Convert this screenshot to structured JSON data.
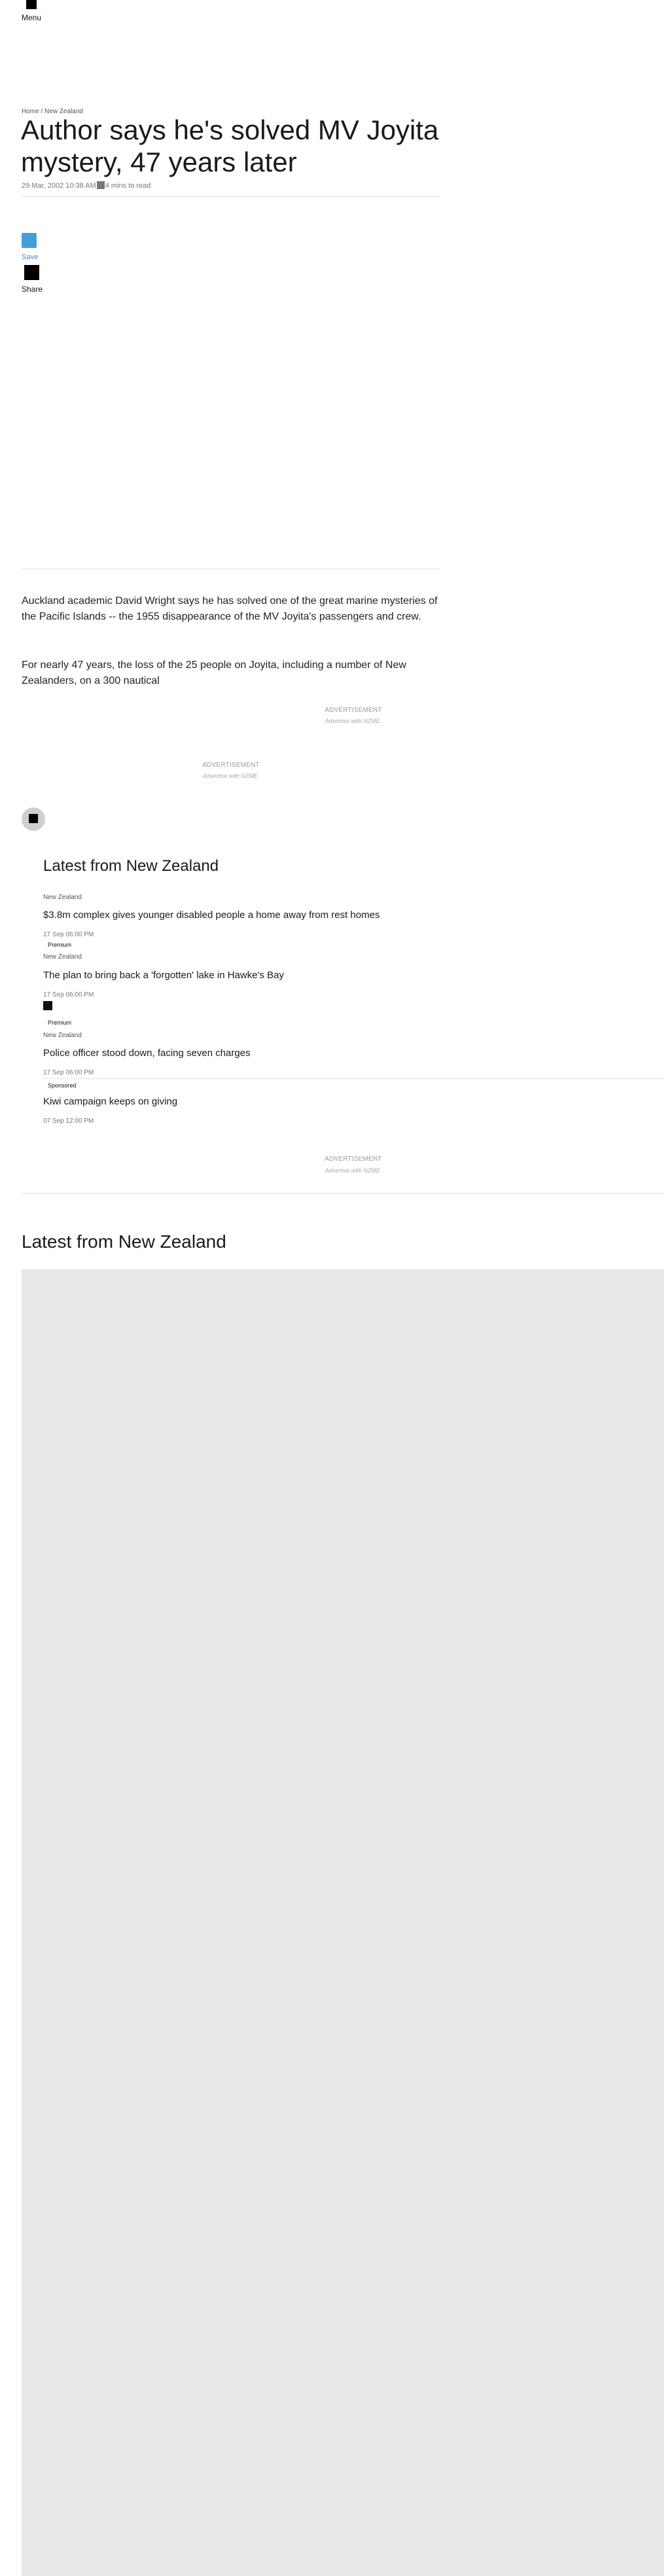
{
  "nav": {
    "menu_label": "Menu"
  },
  "breadcrumb": {
    "home": "Home",
    "separator": " / ",
    "section": "New Zealand"
  },
  "article": {
    "headline": "Author says he's solved MV Joyita mystery, 47 years later",
    "date": "29 Mar, 2002 10:38 AM",
    "read_time": "4 mins to read",
    "paragraph_1": "Auckland academic David Wright says he has solved one of the great marine mysteries of the Pacific Islands -- the 1955 disappearance of the MV Joyita's passengers and crew.",
    "paragraph_2": "For nearly 47 years, the loss of the 25 people on Joyita, including a number of New Zealanders, on a 300 nautical"
  },
  "actions": {
    "save_label": "Save",
    "share_label": "Share"
  },
  "ads": {
    "label": "ADVERTISEMENT",
    "link": "Advertise with NZME."
  },
  "latest": {
    "title": "Latest from New Zealand",
    "items": [
      {
        "section": "New Zealand",
        "title": "$3.8m complex gives younger disabled people a home away from rest homes",
        "date": "17 Sep 06:00 PM",
        "badge": "Premium"
      },
      {
        "section": "New Zealand",
        "title": "The plan to bring back a 'forgotten' lake in Hawke's Bay",
        "date": "17 Sep 06:00 PM",
        "badge": "Premium"
      },
      {
        "section": "New Zealand",
        "title": "Police officer stood down, facing seven charges",
        "date": "17 Sep 06:00 PM",
        "badge": "Sponsored"
      },
      {
        "section": "",
        "title": "Kiwi campaign keeps on giving",
        "date": "07 Sep 12:00 PM",
        "badge": ""
      }
    ]
  },
  "latest_bottom": {
    "title": "Latest from New Zealand"
  },
  "icons": {
    "menu": "menu-icon",
    "clock": "clock-icon",
    "save": "bookmark-icon",
    "share": "share-icon",
    "premium": "premium-icon",
    "avatar": "avatar-icon"
  },
  "colors": {
    "save_accent": "#3f9fde",
    "placeholder_gray": "#e8e8e8"
  }
}
